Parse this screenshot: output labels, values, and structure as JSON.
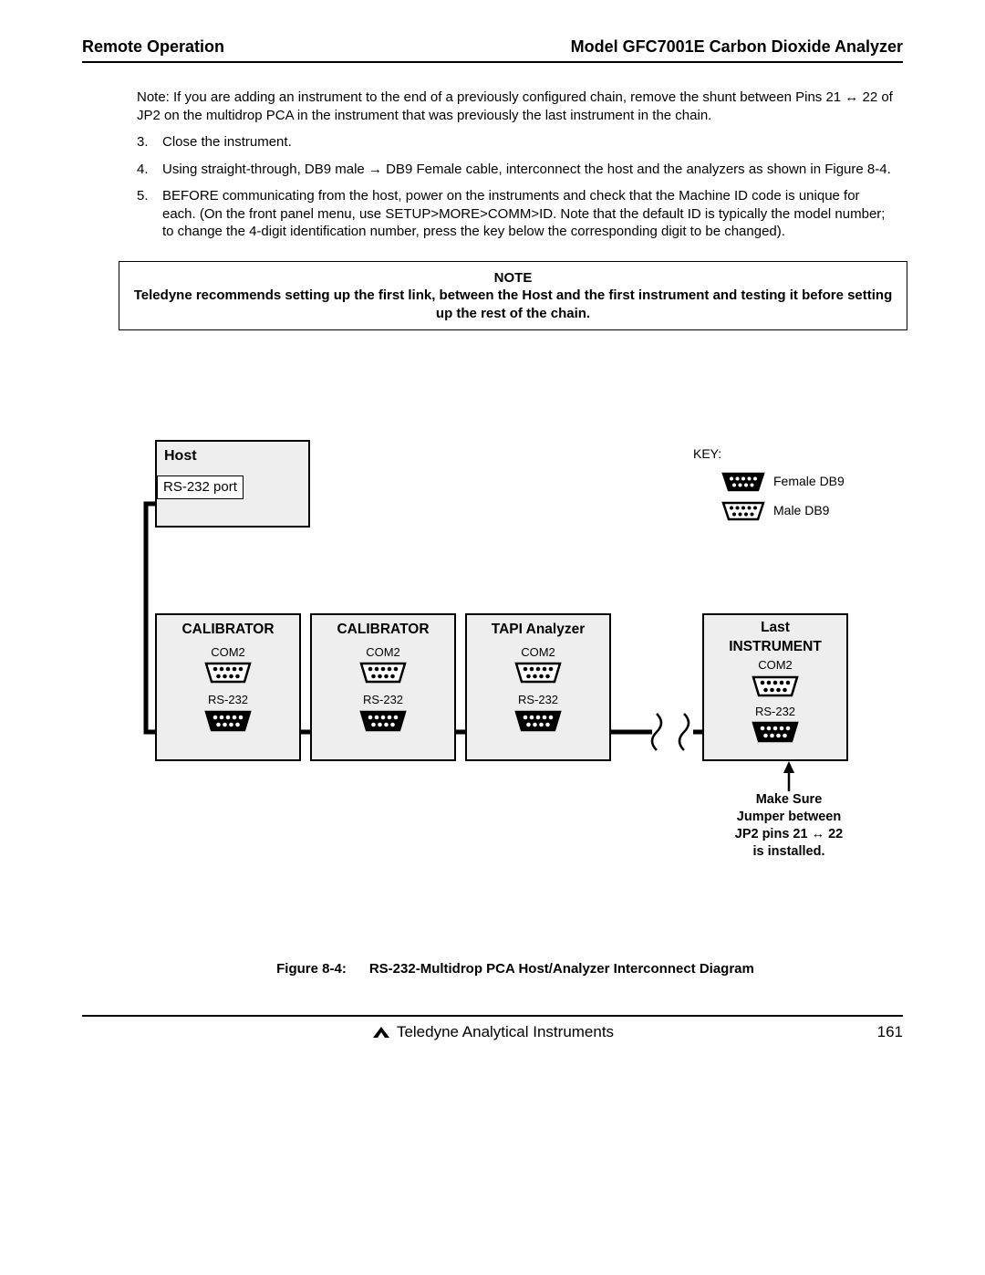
{
  "header": {
    "left": "Remote Operation",
    "right": "Model GFC7001E Carbon Dioxide Analyzer"
  },
  "note_para": "Note: If you are adding an instrument to the end of a previously configured chain, remove the shunt between Pins 21 ↔ 22 of JP2 on the multidrop PCA in the instrument that was previously the last instrument in the chain.",
  "steps": {
    "n3": "3.",
    "t3": "Close the instrument.",
    "n4": "4.",
    "t4": "Using straight-through, DB9 male → DB9 Female cable, interconnect the host and the analyzers as shown in Figure 8-4.",
    "n5": "5.",
    "t5": "BEFORE communicating from the host, power on the instruments and check that the Machine ID code is unique for each. (On the front panel menu, use SETUP>MORE>COMM>ID. Note that the default ID is typically the model number; to change the 4-digit identification number, press the key below the corresponding digit to be changed)."
  },
  "notebox": {
    "title": "NOTE",
    "body": "Teledyne  recommends setting up the first link, between the Host and the first instrument and testing it before setting up the rest of the chain."
  },
  "diagram": {
    "host": {
      "title": "Host",
      "port": "RS-232 port"
    },
    "inst1": {
      "title": "CALIBRATOR",
      "com": "COM2",
      "rs": "RS-232"
    },
    "inst2": {
      "title": "CALIBRATOR",
      "com": "COM2",
      "rs": "RS-232"
    },
    "inst3": {
      "title": "TAPI Analyzer",
      "com": "COM2",
      "rs": "RS-232"
    },
    "inst4": {
      "title1": "Last",
      "title2": "INSTRUMENT",
      "com": "COM2",
      "rs": "RS-232"
    },
    "key_label": "KEY:",
    "key_female": "Female DB9",
    "key_male": "Male DB9",
    "jumper_l1": "Make Sure",
    "jumper_l2": "Jumper between",
    "jumper_l3": "JP2 pins 21 ↔ 22",
    "jumper_l4": "is installed."
  },
  "figure_caption_num": "Figure 8-4:",
  "figure_caption_title": "RS-232-Multidrop PCA Host/Analyzer Interconnect Diagram",
  "footer": {
    "label": "Teledyne Analytical Instruments",
    "page": "161"
  }
}
